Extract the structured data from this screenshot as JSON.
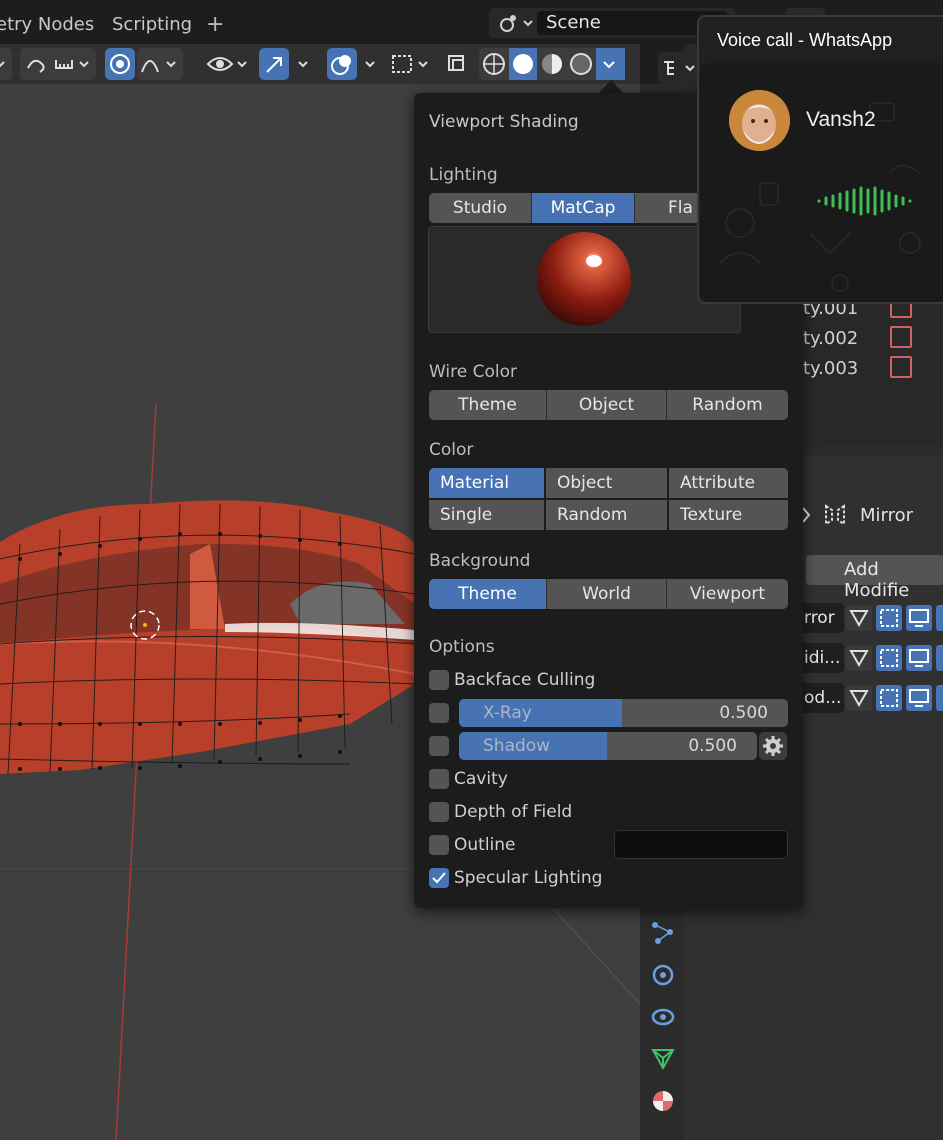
{
  "top_tabs": {
    "geometry_nodes": "etry Nodes",
    "scripting": "Scripting",
    "add": "+"
  },
  "scene": {
    "label": "Scene"
  },
  "popover": {
    "title": "Viewport Shading",
    "lighting": {
      "heading": "Lighting",
      "options": [
        "Studio",
        "MatCap",
        "Fla"
      ],
      "selected": "MatCap"
    },
    "wire_color": {
      "heading": "Wire Color",
      "options": [
        "Theme",
        "Object",
        "Random"
      ]
    },
    "color": {
      "heading": "Color",
      "options": [
        "Material",
        "Object",
        "Attribute",
        "Single",
        "Random",
        "Texture"
      ],
      "selected": "Material"
    },
    "background": {
      "heading": "Background",
      "options": [
        "Theme",
        "World",
        "Viewport"
      ],
      "selected": "Theme"
    },
    "options": {
      "heading": "Options",
      "backface_culling": "Backface Culling",
      "xray_label": "X-Ray",
      "xray_value": "0.500",
      "shadow_label": "Shadow",
      "shadow_value": "0.500",
      "cavity": "Cavity",
      "depth_of_field": "Depth of Field",
      "outline": "Outline",
      "specular_lighting": "Specular Lighting",
      "specular_checked": true
    }
  },
  "outliner": {
    "rows": [
      "ty.001",
      "ty.002",
      "ty.003"
    ]
  },
  "properties": {
    "modifier_name": "Mirror",
    "add_modifier": "Add Modifie",
    "modifier_rows": [
      "rror",
      "idi...",
      "od..."
    ]
  },
  "whatsapp": {
    "title": "Voice call - WhatsApp",
    "caller": "Vansh2"
  },
  "colors": {
    "accent": "#4772b3",
    "panel": "#1c1c1c",
    "viewport": "#3f3f3f",
    "car": "#b8402a",
    "voice_wave": "#3fbf5a"
  }
}
